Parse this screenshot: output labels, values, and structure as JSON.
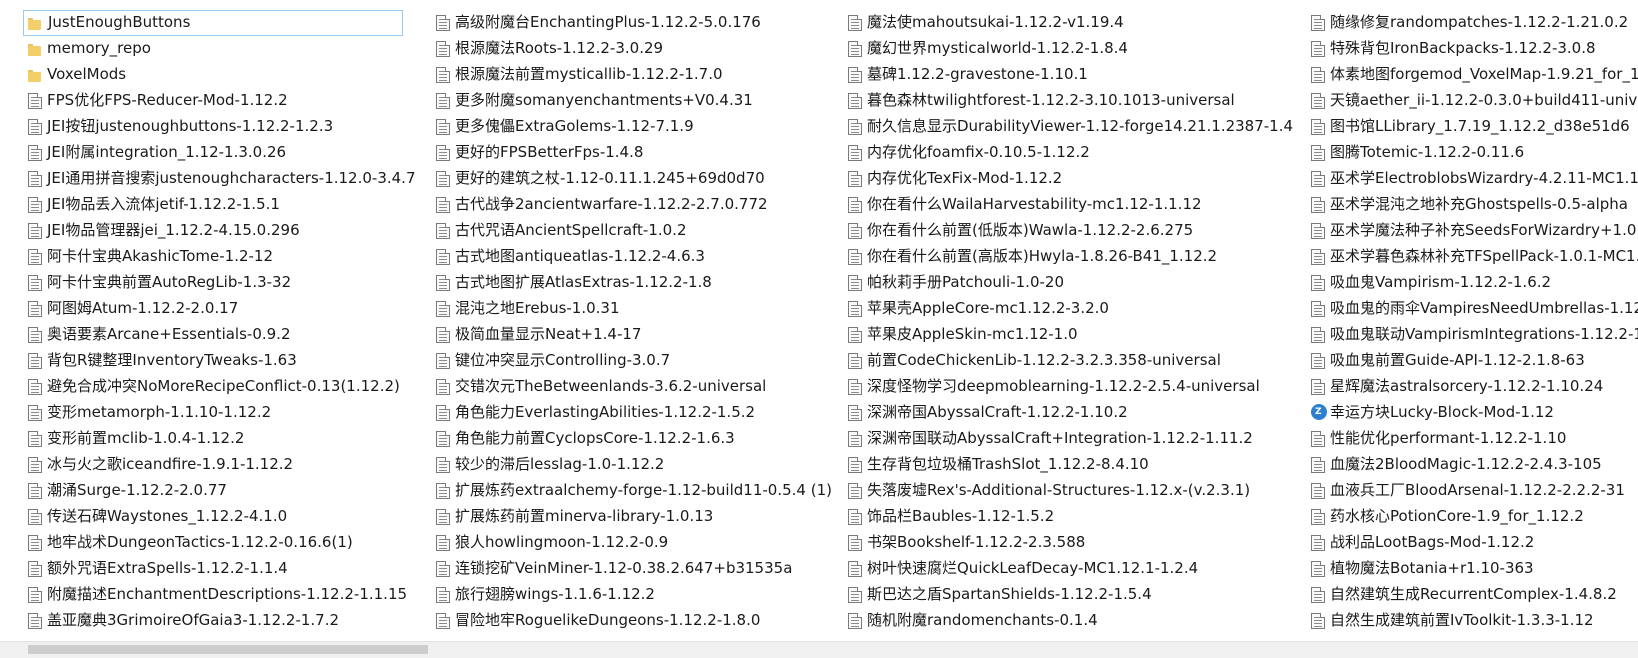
{
  "file_list": {
    "columns": [
      [
        {
          "name": "JustEnoughButtons",
          "icon": "folder-icon",
          "selected": true
        },
        {
          "name": "memory_repo",
          "icon": "folder-icon"
        },
        {
          "name": "VoxelMods",
          "icon": "folder-icon"
        },
        {
          "name": "FPS优化FPS-Reducer-Mod-1.12.2",
          "icon": "jar-file-icon"
        },
        {
          "name": "JEI按钮justenoughbuttons-1.12.2-1.2.3",
          "icon": "jar-file-icon"
        },
        {
          "name": "JEI附属integration_1.12-1.3.0.26",
          "icon": "jar-file-icon"
        },
        {
          "name": "JEI通用拼音搜索justenoughcharacters-1.12.0-3.4.7",
          "icon": "jar-file-icon"
        },
        {
          "name": "JEI物品丢入流体jetif-1.12.2-1.5.1",
          "icon": "jar-file-icon"
        },
        {
          "name": "JEI物品管理器jei_1.12.2-4.15.0.296",
          "icon": "jar-file-icon"
        },
        {
          "name": "阿卡什宝典AkashicTome-1.2-12",
          "icon": "jar-file-icon"
        },
        {
          "name": "阿卡什宝典前置AutoRegLib-1.3-32",
          "icon": "jar-file-icon"
        },
        {
          "name": "阿图姆Atum-1.12.2-2.0.17",
          "icon": "jar-file-icon"
        },
        {
          "name": "奥语要素Arcane+Essentials-0.9.2",
          "icon": "jar-file-icon"
        },
        {
          "name": "背包R键整理InventoryTweaks-1.63",
          "icon": "jar-file-icon"
        },
        {
          "name": "避免合成冲突NoMoreRecipeConflict-0.13(1.12.2)",
          "icon": "jar-file-icon"
        },
        {
          "name": "变形metamorph-1.1.10-1.12.2",
          "icon": "jar-file-icon"
        },
        {
          "name": "变形前置mclib-1.0.4-1.12.2",
          "icon": "jar-file-icon"
        },
        {
          "name": "冰与火之歌iceandfire-1.9.1-1.12.2",
          "icon": "jar-file-icon"
        },
        {
          "name": "潮涌Surge-1.12.2-2.0.77",
          "icon": "jar-file-icon"
        },
        {
          "name": "传送石碑Waystones_1.12.2-4.1.0",
          "icon": "jar-file-icon"
        },
        {
          "name": "地牢战术DungeonTactics-1.12.2-0.16.6(1)",
          "icon": "jar-file-icon"
        },
        {
          "name": "额外咒语ExtraSpells-1.12.2-1.1.4",
          "icon": "jar-file-icon"
        },
        {
          "name": "附魔描述EnchantmentDescriptions-1.12.2-1.1.15",
          "icon": "jar-file-icon"
        },
        {
          "name": "盖亚魔典3GrimoireOfGaia3-1.12.2-1.7.2",
          "icon": "jar-file-icon"
        }
      ],
      [
        {
          "name": "高级附魔台EnchantingPlus-1.12.2-5.0.176",
          "icon": "jar-file-icon"
        },
        {
          "name": "根源魔法Roots-1.12.2-3.0.29",
          "icon": "jar-file-icon"
        },
        {
          "name": "根源魔法前置mysticallib-1.12.2-1.7.0",
          "icon": "jar-file-icon"
        },
        {
          "name": "更多附魔somanyenchantments+V0.4.31",
          "icon": "jar-file-icon"
        },
        {
          "name": "更多傀儡ExtraGolems-1.12-7.1.9",
          "icon": "jar-file-icon"
        },
        {
          "name": "更好的FPSBetterFps-1.4.8",
          "icon": "jar-file-icon"
        },
        {
          "name": "更好的建筑之杖-1.12-0.11.1.245+69d0d70",
          "icon": "jar-file-icon"
        },
        {
          "name": "古代战争2ancientwarfare-1.12.2-2.7.0.772",
          "icon": "jar-file-icon"
        },
        {
          "name": "古代咒语AncientSpellcraft-1.0.2",
          "icon": "jar-file-icon"
        },
        {
          "name": "古式地图antiqueatlas-1.12.2-4.6.3",
          "icon": "jar-file-icon"
        },
        {
          "name": "古式地图扩展AtlasExtras-1.12.2-1.8",
          "icon": "jar-file-icon"
        },
        {
          "name": "混沌之地Erebus-1.0.31",
          "icon": "jar-file-icon"
        },
        {
          "name": "极简血量显示Neat+1.4-17",
          "icon": "jar-file-icon"
        },
        {
          "name": "键位冲突显示Controlling-3.0.7",
          "icon": "jar-file-icon"
        },
        {
          "name": "交错次元TheBetweenlands-3.6.2-universal",
          "icon": "jar-file-icon"
        },
        {
          "name": "角色能力EverlastingAbilities-1.12.2-1.5.2",
          "icon": "jar-file-icon"
        },
        {
          "name": "角色能力前置CyclopsCore-1.12.2-1.6.3",
          "icon": "jar-file-icon"
        },
        {
          "name": "较少的滞后lesslag-1.0-1.12.2",
          "icon": "jar-file-icon"
        },
        {
          "name": "扩展炼药extraalchemy-forge-1.12-build11-0.5.4 (1)",
          "icon": "jar-file-icon"
        },
        {
          "name": "扩展炼药前置minerva-library-1.0.13",
          "icon": "jar-file-icon"
        },
        {
          "name": "狼人howlingmoon-1.12.2-0.9",
          "icon": "jar-file-icon"
        },
        {
          "name": "连锁挖矿VeinMiner-1.12-0.38.2.647+b31535a",
          "icon": "jar-file-icon"
        },
        {
          "name": "旅行翅膀wings-1.1.6-1.12.2",
          "icon": "jar-file-icon"
        },
        {
          "name": "冒险地牢RoguelikeDungeons-1.12.2-1.8.0",
          "icon": "jar-file-icon"
        }
      ],
      [
        {
          "name": "魔法使mahoutsukai-1.12.2-v1.19.4",
          "icon": "jar-file-icon"
        },
        {
          "name": "魔幻世界mysticalworld-1.12.2-1.8.4",
          "icon": "jar-file-icon"
        },
        {
          "name": "墓碑1.12.2-gravestone-1.10.1",
          "icon": "jar-file-icon"
        },
        {
          "name": "暮色森林twilightforest-1.12.2-3.10.1013-universal",
          "icon": "jar-file-icon"
        },
        {
          "name": "耐久信息显示DurabilityViewer-1.12-forge14.21.1.2387-1.4",
          "icon": "jar-file-icon"
        },
        {
          "name": "内存优化foamfix-0.10.5-1.12.2",
          "icon": "jar-file-icon"
        },
        {
          "name": "内存优化TexFix-Mod-1.12.2",
          "icon": "jar-file-icon"
        },
        {
          "name": "你在看什么WailaHarvestability-mc1.12-1.1.12",
          "icon": "jar-file-icon"
        },
        {
          "name": "你在看什么前置(低版本)Wawla-1.12.2-2.6.275",
          "icon": "jar-file-icon"
        },
        {
          "name": "你在看什么前置(高版本)Hwyla-1.8.26-B41_1.12.2",
          "icon": "jar-file-icon"
        },
        {
          "name": "帕秋莉手册Patchouli-1.0-20",
          "icon": "jar-file-icon"
        },
        {
          "name": "苹果壳AppleCore-mc1.12.2-3.2.0",
          "icon": "jar-file-icon"
        },
        {
          "name": "苹果皮AppleSkin-mc1.12-1.0",
          "icon": "jar-file-icon"
        },
        {
          "name": "前置CodeChickenLib-1.12.2-3.2.3.358-universal",
          "icon": "jar-file-icon"
        },
        {
          "name": "深度怪物学习deepmoblearning-1.12.2-2.5.4-universal",
          "icon": "jar-file-icon"
        },
        {
          "name": "深渊帝国AbyssalCraft-1.12.2-1.10.2",
          "icon": "jar-file-icon"
        },
        {
          "name": "深渊帝国联动AbyssalCraft+Integration-1.12.2-1.11.2",
          "icon": "jar-file-icon"
        },
        {
          "name": "生存背包垃圾桶TrashSlot_1.12.2-8.4.10",
          "icon": "jar-file-icon"
        },
        {
          "name": "失落废墟Rex's-Additional-Structures-1.12.x-(v.2.3.1)",
          "icon": "jar-file-icon"
        },
        {
          "name": "饰品栏Baubles-1.12-1.5.2",
          "icon": "jar-file-icon"
        },
        {
          "name": "书架Bookshelf-1.12.2-2.3.588",
          "icon": "jar-file-icon"
        },
        {
          "name": "树叶快速腐烂QuickLeafDecay-MC1.12.1-1.2.4",
          "icon": "jar-file-icon"
        },
        {
          "name": "斯巴达之盾SpartanShields-1.12.2-1.5.4",
          "icon": "jar-file-icon"
        },
        {
          "name": "随机附魔randomenchants-0.1.4",
          "icon": "jar-file-icon"
        }
      ],
      [
        {
          "name": "随缘修复randompatches-1.12.2-1.21.0.2",
          "icon": "jar-file-icon"
        },
        {
          "name": "特殊背包IronBackpacks-1.12.2-3.0.8",
          "icon": "jar-file-icon"
        },
        {
          "name": "体素地图forgemod_VoxelMap-1.9.21_for_1.",
          "icon": "jar-file-icon"
        },
        {
          "name": "天镜aether_ii-1.12.2-0.3.0+build411-univers",
          "icon": "jar-file-icon"
        },
        {
          "name": "图书馆LLibrary_1.7.19_1.12.2_d38e51d6",
          "icon": "jar-file-icon"
        },
        {
          "name": "图腾Totemic-1.12.2-0.11.6",
          "icon": "jar-file-icon"
        },
        {
          "name": "巫术学ElectroblobsWizardry-4.2.11-MC1.12",
          "icon": "jar-file-icon"
        },
        {
          "name": "巫术学混沌之地补充Ghostspells-0.5-alpha",
          "icon": "jar-file-icon"
        },
        {
          "name": "巫术学魔法种子补充SeedsForWizardry+1.0+",
          "icon": "jar-file-icon"
        },
        {
          "name": "巫术学暮色森林补充TFSpellPack-1.0.1-MC1.1",
          "icon": "jar-file-icon"
        },
        {
          "name": "吸血鬼Vampirism-1.12.2-1.6.2",
          "icon": "jar-file-icon"
        },
        {
          "name": "吸血鬼的雨伞VampiresNeedUmbrellas-1.12.",
          "icon": "jar-file-icon"
        },
        {
          "name": "吸血鬼联动VampirismIntegrations-1.12.2-1.",
          "icon": "jar-file-icon"
        },
        {
          "name": "吸血鬼前置Guide-API-1.12-2.1.8-63",
          "icon": "jar-file-icon"
        },
        {
          "name": "星辉魔法astralsorcery-1.12.2-1.10.24",
          "icon": "jar-file-icon"
        },
        {
          "name": "幸运方块Lucky-Block-Mod-1.12",
          "icon": "zip-archive-icon"
        },
        {
          "name": "性能优化performant-1.12.2-1.10",
          "icon": "jar-file-icon"
        },
        {
          "name": "血魔法2BloodMagic-1.12.2-2.4.3-105",
          "icon": "jar-file-icon"
        },
        {
          "name": "血液兵工厂BloodArsenal-1.12.2-2.2.2-31",
          "icon": "jar-file-icon"
        },
        {
          "name": "药水核心PotionCore-1.9_for_1.12.2",
          "icon": "jar-file-icon"
        },
        {
          "name": "战利品LootBags-Mod-1.12.2",
          "icon": "jar-file-icon"
        },
        {
          "name": "植物魔法Botania+r1.10-363",
          "icon": "jar-file-icon"
        },
        {
          "name": "自然建筑生成RecurrentComplex-1.4.8.2",
          "icon": "jar-file-icon"
        },
        {
          "name": "自然生成建筑前置IvToolkit-1.3.3-1.12",
          "icon": "jar-file-icon"
        }
      ]
    ]
  }
}
